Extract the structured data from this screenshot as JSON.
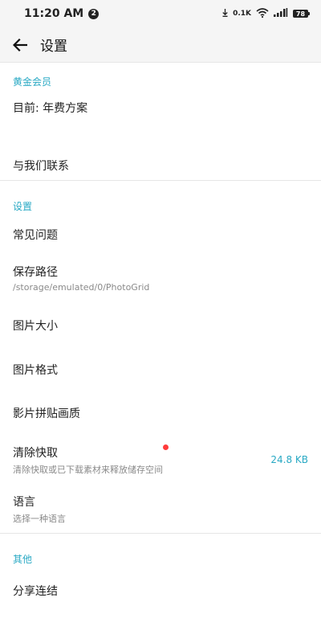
{
  "status_bar": {
    "time": "11:20 AM",
    "notification_count": "2",
    "net_speed": "0.1K",
    "battery": "78"
  },
  "app_bar": {
    "title": "设置"
  },
  "sections": {
    "vip": {
      "header": "黄金会员",
      "current_plan": "目前: 年费方案",
      "contact_us": "与我们联系"
    },
    "settings": {
      "header": "设置",
      "faq": "常见问题",
      "save_path": {
        "title": "保存路径",
        "subtitle": "/storage/emulated/0/PhotoGrid"
      },
      "image_size": "图片大小",
      "image_format": "图片格式",
      "video_quality": "影片拼贴画质",
      "clear_cache": {
        "title": "清除快取",
        "subtitle": "清除快取或已下载素材来释放储存空间",
        "value": "24.8 KB"
      },
      "language": {
        "title": "语言",
        "subtitle": "选择一种语言"
      }
    },
    "other": {
      "header": "其他",
      "share_link": "分享连结"
    }
  },
  "colors": {
    "accent": "#29a9c4",
    "badge_dot": "#ff3b3b",
    "bar_bg": "#f5f5f5"
  }
}
